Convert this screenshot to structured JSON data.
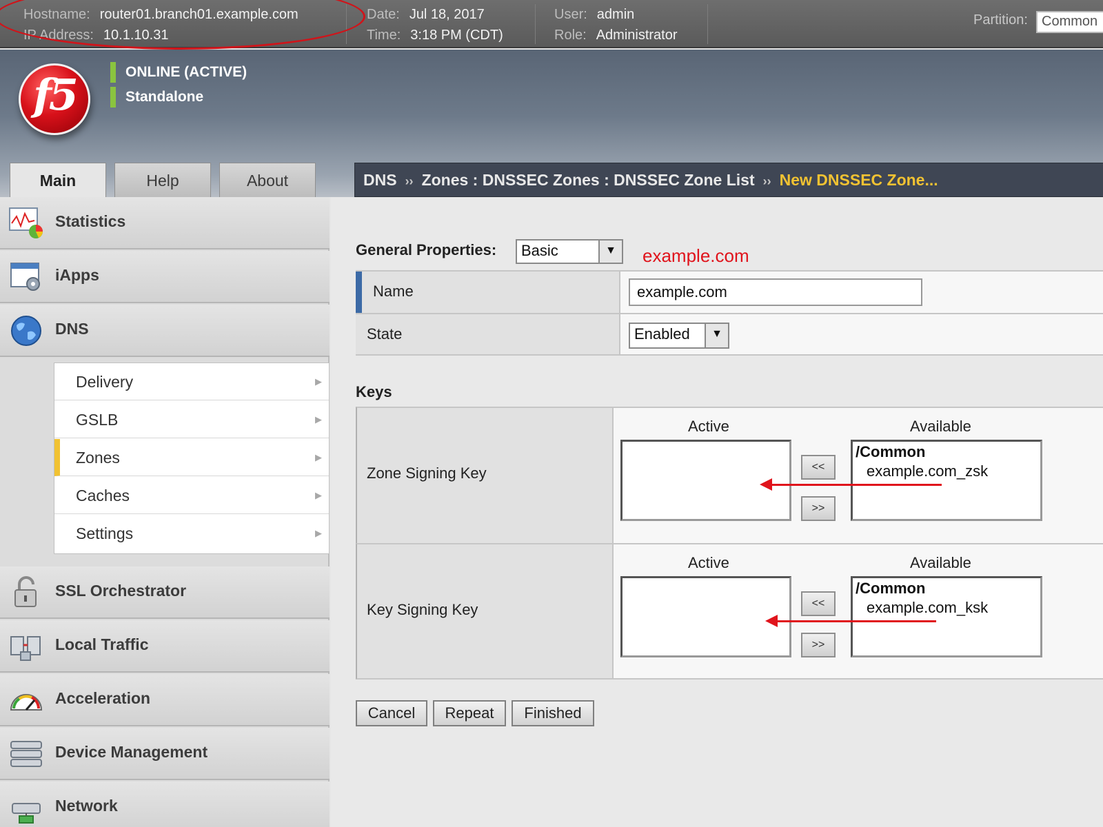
{
  "status_bar": {
    "hostname_label": "Hostname:",
    "hostname": "router01.branch01.example.com",
    "ip_label": "IP Address:",
    "ip": "10.1.10.31",
    "date_label": "Date:",
    "date": "Jul 18, 2017",
    "time_label": "Time:",
    "time": "3:18 PM (CDT)",
    "user_label": "User:",
    "user": "admin",
    "role_label": "Role:",
    "role": "Administrator",
    "partition_label": "Partition:",
    "partition": "Common"
  },
  "banner": {
    "logo_text": "f5",
    "status": "ONLINE (ACTIVE)",
    "mode": "Standalone",
    "accent": "#8ac43f"
  },
  "tabs": [
    {
      "label": "Main"
    },
    {
      "label": "Help"
    },
    {
      "label": "About"
    }
  ],
  "breadcrumb": {
    "root": "DNS",
    "sep": "››",
    "middle": "Zones : DNSSEC Zones : DNSSEC Zone List",
    "current": "New DNSSEC Zone...",
    "current_color": "#f1c232"
  },
  "sidebar": {
    "items": [
      {
        "label": "Statistics",
        "icon": "statistics-icon"
      },
      {
        "label": "iApps",
        "icon": "iapps-icon"
      },
      {
        "label": "DNS",
        "icon": "globe-icon"
      },
      {
        "label": "SSL Orchestrator",
        "icon": "padlock-icon"
      },
      {
        "label": "Local Traffic",
        "icon": "local-traffic-icon"
      },
      {
        "label": "Acceleration",
        "icon": "gauge-icon"
      },
      {
        "label": "Device Management",
        "icon": "server-icon"
      },
      {
        "label": "Network",
        "icon": "network-icon"
      }
    ],
    "dns_subitems": [
      {
        "label": "Delivery"
      },
      {
        "label": "GSLB"
      },
      {
        "label": "Zones",
        "selected": true
      },
      {
        "label": "Caches"
      },
      {
        "label": "Settings"
      }
    ]
  },
  "form": {
    "general_label": "General Properties:",
    "general_mode": "Basic",
    "annotation": "example.com",
    "name_label": "Name",
    "name_value": "example.com",
    "state_label": "State",
    "state_value": "Enabled",
    "keys_title": "Keys",
    "zsk": {
      "label": "Zone Signing Key",
      "active_header": "Active",
      "available_header": "Available",
      "group": "/Common",
      "item": "example.com_zsk",
      "add_btn": "<<",
      "remove_btn": ">>"
    },
    "ksk": {
      "label": "Key Signing Key",
      "active_header": "Active",
      "available_header": "Available",
      "group": "/Common",
      "item": "example.com_ksk",
      "add_btn": "<<",
      "remove_btn": ">>"
    },
    "buttons": {
      "cancel": "Cancel",
      "repeat": "Repeat",
      "finished": "Finished"
    }
  }
}
